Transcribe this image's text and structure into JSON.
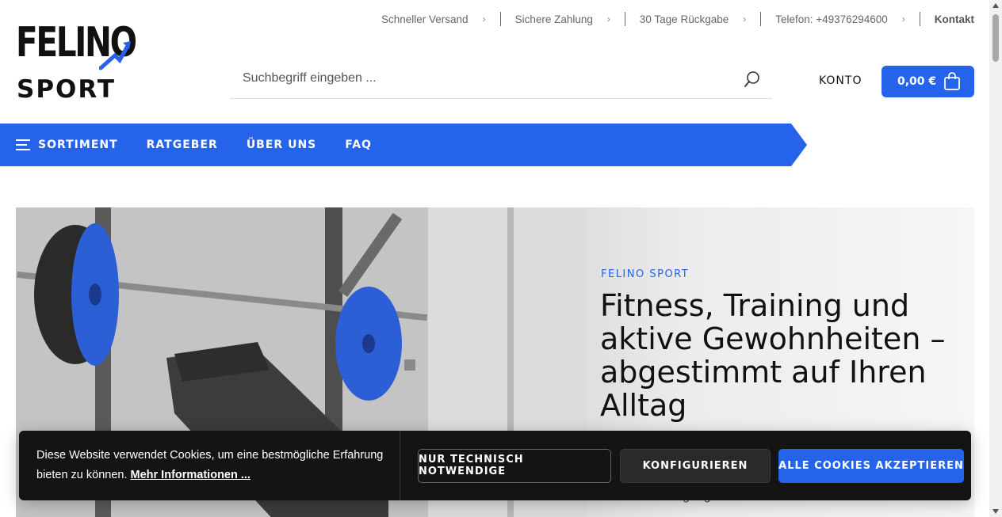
{
  "topbar": {
    "items": [
      "Schneller Versand",
      "Sichere Zahlung",
      "30 Tage Rückgabe",
      "Telefon: +49376294600"
    ],
    "contact": "Kontakt"
  },
  "logo": {
    "line1": "FELINO",
    "line2": "SPORT"
  },
  "search": {
    "placeholder": "Suchbegriff eingeben ..."
  },
  "header": {
    "account_label": "KONTO",
    "cart_total": "0,00 €"
  },
  "nav": {
    "items": [
      "SORTIMENT",
      "RATGEBER",
      "ÜBER UNS",
      "FAQ"
    ]
  },
  "hero": {
    "eyebrow": "FELINO SPORT",
    "title": "Fitness, Training und aktive Gewohnheiten – abgestimmt auf Ihren Alltag",
    "subtitle": "für mehr Bewegung zu Hause und im Freien."
  },
  "cookie": {
    "text": "Diese Website verwendet Cookies, um eine bestmögliche Erfahrung bieten zu können.",
    "more_link": "Mehr Informationen ...",
    "btn_necessary": "NUR TECHNISCH NOTWENDIGE",
    "btn_configure": "KONFIGURIEREN",
    "btn_accept": "ALLE COOKIES AKZEPTIEREN"
  },
  "colors": {
    "accent": "#2563eb",
    "banner_bg": "#141414"
  }
}
